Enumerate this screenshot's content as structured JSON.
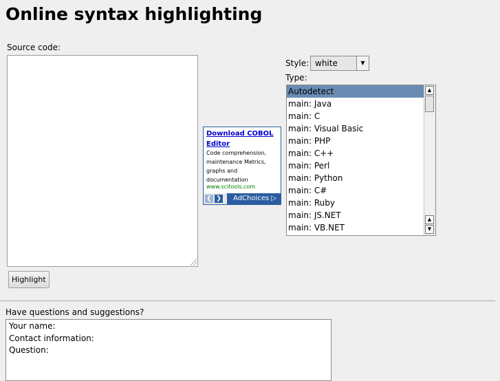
{
  "page": {
    "title": "Online syntax highlighting"
  },
  "source": {
    "label": "Source code:",
    "value": ""
  },
  "highlight_button": {
    "label": "Highlight"
  },
  "ad": {
    "title_line1": "Download COBOL",
    "title_line2": "Editor",
    "desc_lines": [
      "Code comprehension,",
      "maintenance Metrics,",
      "graphs and",
      "documentation"
    ],
    "url": "www.scitools.com",
    "choices_label": "AdChoices ▷"
  },
  "style": {
    "label": "Style:",
    "selected": "white"
  },
  "type": {
    "label": "Type:",
    "selected_index": 0,
    "items": [
      "Autodetect",
      "main: Java",
      "main: C",
      "main: Visual Basic",
      "main: PHP",
      "main: C++",
      "main: Perl",
      "main: Python",
      "main: C#",
      "main: Ruby",
      "main: JS.NET",
      "main: VB.NET"
    ]
  },
  "feedback": {
    "heading": "Have questions and suggestions?",
    "lines": [
      "Your name:",
      "Contact information:",
      "Question:"
    ]
  },
  "colors": {
    "background": "#efefef",
    "list_selection": "#6a8cb3",
    "ad_border": "#2a5da0",
    "ad_link": "#0000cc",
    "ad_url": "#008000"
  }
}
